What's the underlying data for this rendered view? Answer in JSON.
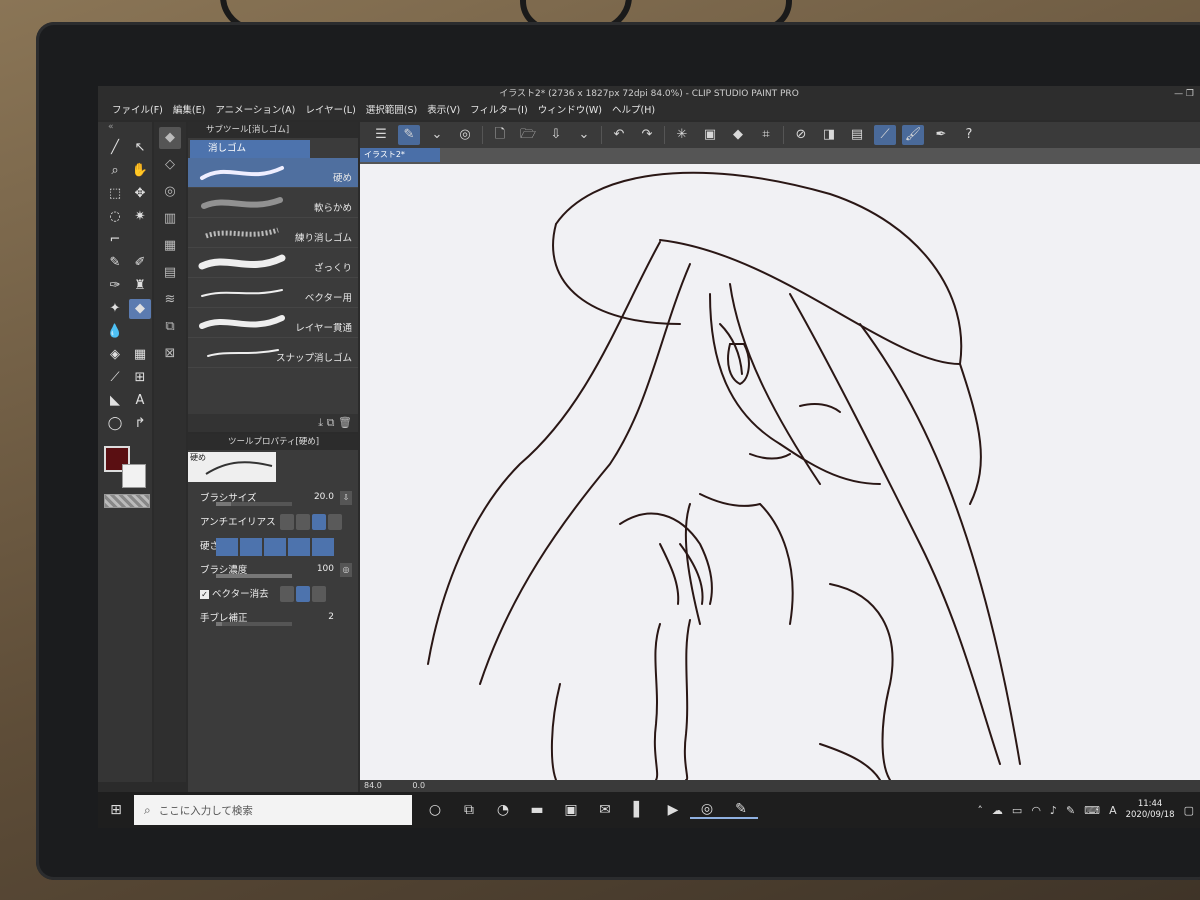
{
  "window": {
    "title": "イラスト2* (2736 x 1827px 72dpi 84.0%)  - CLIP STUDIO PAINT PRO",
    "controls": "—   ❐"
  },
  "menu": [
    "ファイル(F)",
    "編集(E)",
    "アニメーション(A)",
    "レイヤー(L)",
    "選択範囲(S)",
    "表示(V)",
    "フィルター(I)",
    "ウィンドウ(W)",
    "ヘルプ(H)"
  ],
  "toolcol": {
    "collapse": "«"
  },
  "subtool": {
    "tab": "サブツール[消しゴム]",
    "group": "消しゴム",
    "brushes": [
      {
        "label": "硬め",
        "selected": true
      },
      {
        "label": "軟らかめ"
      },
      {
        "label": "練り消しゴム"
      },
      {
        "label": "ざっくり"
      },
      {
        "label": "ベクター用"
      },
      {
        "label": "レイヤー貫通"
      },
      {
        "label": "スナップ消しゴム"
      }
    ]
  },
  "props": {
    "tab": "ツールプロパティ[硬め]",
    "preview_tag": "硬め",
    "brush_size": {
      "label": "ブラシサイズ",
      "value": "20.0"
    },
    "antialias": {
      "label": "アンチエイリアス"
    },
    "hardness": {
      "label": "硬さ"
    },
    "density": {
      "label": "ブラシ濃度",
      "value": "100"
    },
    "vector_erase": {
      "label": "ベクター消去",
      "checked": true
    },
    "stabilization": {
      "label": "手ブレ補正",
      "value": "2"
    }
  },
  "document": {
    "tab": "イラスト2*",
    "zoom": "84.0",
    "angle": "0.0"
  },
  "taskbar": {
    "search_placeholder": "ここに入力して検索",
    "time": "11:44",
    "date": "2020/09/18",
    "ime": "A"
  },
  "colors": {
    "fg": "#5a0f12",
    "bg": "#f2f2f2",
    "accent": "#4d73ad"
  }
}
